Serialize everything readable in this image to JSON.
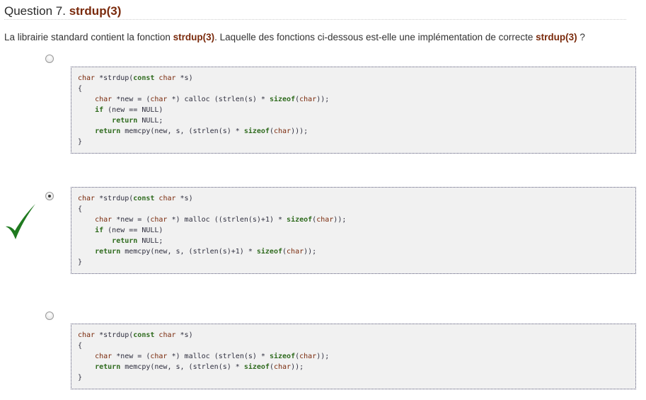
{
  "question": {
    "label": "Question 7.",
    "function": "strdup(3)",
    "text_before": "La librairie standard contient la fonction ",
    "text_func": "strdup(3)",
    "text_middle": ". Laquelle des fonctions ci-dessous est-elle une implémentation de correcte ",
    "text_func2": "strdup(3)",
    "text_after": " ?"
  },
  "colors": {
    "accent": "#7a2a0c",
    "keyword": "#2f6b1e",
    "check": "#1f7a1f"
  },
  "options": [
    {
      "selected": false,
      "correct": false,
      "lines": [
        [
          [
            "ty",
            "char"
          ],
          [
            "nm",
            " *strdup("
          ],
          [
            "kw",
            "const"
          ],
          [
            "nm",
            " "
          ],
          [
            "ty",
            "char"
          ],
          [
            "nm",
            " *s)"
          ]
        ],
        [
          [
            "nm",
            "{"
          ]
        ],
        [
          [
            "nm",
            "    "
          ],
          [
            "ty",
            "char"
          ],
          [
            "nm",
            " *new = ("
          ],
          [
            "ty",
            "char"
          ],
          [
            "nm",
            " *) calloc (strlen(s) * "
          ],
          [
            "kw",
            "sizeof"
          ],
          [
            "nm",
            "("
          ],
          [
            "ty",
            "char"
          ],
          [
            "nm",
            "));"
          ]
        ],
        [
          [
            "nm",
            "    "
          ],
          [
            "kw",
            "if"
          ],
          [
            "nm",
            " (new == NULL)"
          ]
        ],
        [
          [
            "nm",
            "        "
          ],
          [
            "kw",
            "return"
          ],
          [
            "nm",
            " NULL;"
          ]
        ],
        [
          [
            "nm",
            "    "
          ],
          [
            "kw",
            "return"
          ],
          [
            "nm",
            " memcpy(new, s, (strlen(s) * "
          ],
          [
            "kw",
            "sizeof"
          ],
          [
            "nm",
            "("
          ],
          [
            "ty",
            "char"
          ],
          [
            "nm",
            ")));"
          ]
        ],
        [
          [
            "nm",
            "}"
          ]
        ]
      ]
    },
    {
      "selected": true,
      "correct": true,
      "lines": [
        [
          [
            "ty",
            "char"
          ],
          [
            "nm",
            " *strdup("
          ],
          [
            "kw",
            "const"
          ],
          [
            "nm",
            " "
          ],
          [
            "ty",
            "char"
          ],
          [
            "nm",
            " *s)"
          ]
        ],
        [
          [
            "nm",
            "{"
          ]
        ],
        [
          [
            "nm",
            "    "
          ],
          [
            "ty",
            "char"
          ],
          [
            "nm",
            " *new = ("
          ],
          [
            "ty",
            "char"
          ],
          [
            "nm",
            " *) malloc ((strlen(s)+1) * "
          ],
          [
            "kw",
            "sizeof"
          ],
          [
            "nm",
            "("
          ],
          [
            "ty",
            "char"
          ],
          [
            "nm",
            "));"
          ]
        ],
        [
          [
            "nm",
            "    "
          ],
          [
            "kw",
            "if"
          ],
          [
            "nm",
            " (new == NULL)"
          ]
        ],
        [
          [
            "nm",
            "        "
          ],
          [
            "kw",
            "return"
          ],
          [
            "nm",
            " NULL;"
          ]
        ],
        [
          [
            "nm",
            "    "
          ],
          [
            "kw",
            "return"
          ],
          [
            "nm",
            " memcpy(new, s, (strlen(s)+1) * "
          ],
          [
            "kw",
            "sizeof"
          ],
          [
            "nm",
            "("
          ],
          [
            "ty",
            "char"
          ],
          [
            "nm",
            "));"
          ]
        ],
        [
          [
            "nm",
            "}"
          ]
        ]
      ]
    },
    {
      "selected": false,
      "correct": false,
      "lines": [
        [
          [
            "ty",
            "char"
          ],
          [
            "nm",
            " *strdup("
          ],
          [
            "kw",
            "const"
          ],
          [
            "nm",
            " "
          ],
          [
            "ty",
            "char"
          ],
          [
            "nm",
            " *s)"
          ]
        ],
        [
          [
            "nm",
            "{"
          ]
        ],
        [
          [
            "nm",
            "    "
          ],
          [
            "ty",
            "char"
          ],
          [
            "nm",
            " *new = ("
          ],
          [
            "ty",
            "char"
          ],
          [
            "nm",
            " *) malloc (strlen(s) * "
          ],
          [
            "kw",
            "sizeof"
          ],
          [
            "nm",
            "("
          ],
          [
            "ty",
            "char"
          ],
          [
            "nm",
            "));"
          ]
        ],
        [
          [
            "nm",
            "    "
          ],
          [
            "kw",
            "return"
          ],
          [
            "nm",
            " memcpy(new, s, (strlen(s) * "
          ],
          [
            "kw",
            "sizeof"
          ],
          [
            "nm",
            "("
          ],
          [
            "ty",
            "char"
          ],
          [
            "nm",
            "));"
          ]
        ],
        [
          [
            "nm",
            "}"
          ]
        ]
      ]
    }
  ]
}
